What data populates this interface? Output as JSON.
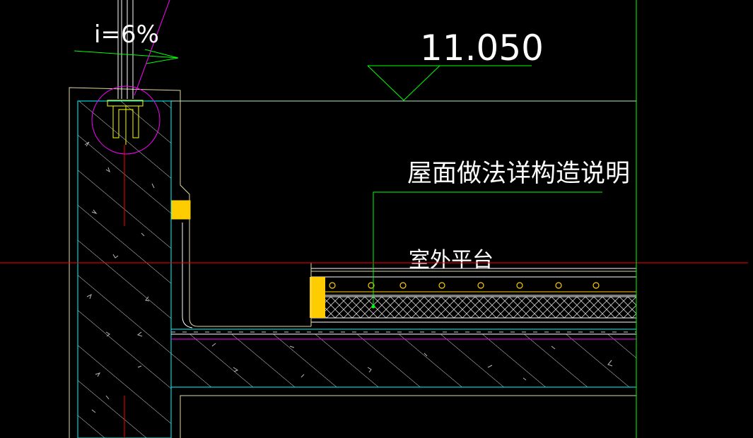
{
  "drawing": {
    "elevation_label": "11.050",
    "slope_label": "i=6%",
    "callout_title": "屋面做法详构造说明",
    "area_label": "室外平台"
  },
  "colors": {
    "background": "#000000",
    "cyan": "#00ffff",
    "green": "#00ff00",
    "yellow": "#ffff00",
    "gold": "#ffcc00",
    "magenta": "#ff00ff",
    "red": "#ff0000",
    "beige": "#e0d8a0",
    "white": "#ffffff",
    "hatch": "#c8c8c8"
  }
}
